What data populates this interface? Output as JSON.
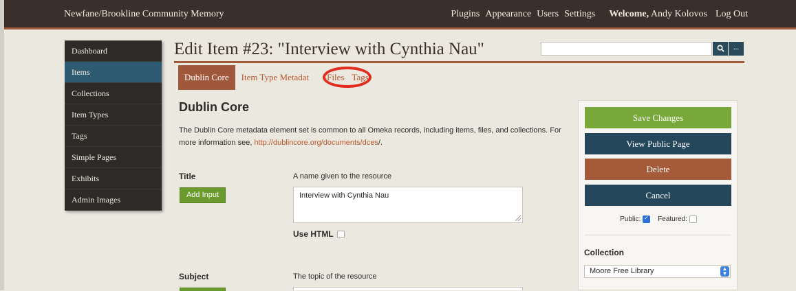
{
  "site": {
    "title": "Newfane/Brookline Community Memory",
    "nav": [
      "Plugins",
      "Appearance",
      "Users",
      "Settings"
    ],
    "welcome_prefix": "Welcome,",
    "user_name": "Andy Kolovos",
    "logout": "Log Out"
  },
  "sidebar": {
    "items": [
      {
        "label": "Dashboard"
      },
      {
        "label": "Items"
      },
      {
        "label": "Collections"
      },
      {
        "label": "Item Types"
      },
      {
        "label": "Tags"
      },
      {
        "label": "Simple Pages"
      },
      {
        "label": "Exhibits"
      },
      {
        "label": "Admin Images"
      }
    ],
    "active": "Items"
  },
  "page": {
    "title": "Edit Item #23: \"Interview with Cynthia Nau\"",
    "search": {
      "icon": "search-icon",
      "more_label": "..."
    }
  },
  "tabs": [
    {
      "label": "Dublin Core"
    },
    {
      "label": "Item Type Metadat"
    },
    {
      "label": "Files"
    },
    {
      "label": "Tags"
    }
  ],
  "section": {
    "heading": "Dublin Core",
    "description_before": "The Dublin Core metadata element set is common to all Omeka records, including items, files, and collections. For more information see, ",
    "description_link": "http://dublincore.org/documents/dces",
    "description_after": "/."
  },
  "fields": {
    "title": {
      "label": "Title",
      "description": "A name given to the resource",
      "add_input": "Add Input",
      "value": "Interview with Cynthia Nau",
      "use_html": "Use HTML"
    },
    "subject": {
      "label": "Subject",
      "description": "The topic of the resource"
    }
  },
  "panel": {
    "save": "Save Changes",
    "view": "View Public Page",
    "delete": "Delete",
    "cancel": "Cancel",
    "public_label": "Public:",
    "featured_label": "Featured:",
    "public_checked": true,
    "featured_checked": false,
    "collection_label": "Collection",
    "collection_value": "Moore Free Library"
  },
  "colors": {
    "accent": "#a55a3a",
    "highlight_circle": "#e32b1f",
    "nav_active": "#2f5b72"
  }
}
